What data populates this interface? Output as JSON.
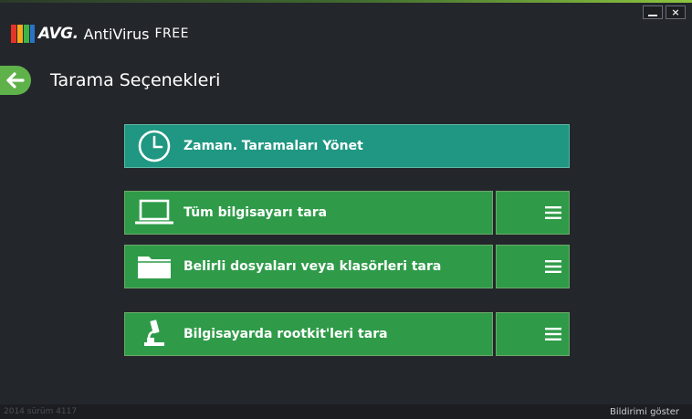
{
  "window": {
    "brand": "AVG.",
    "product": "AntiVirus",
    "edition": "FREE",
    "minimize_icon": "minimize-icon",
    "close_symbol": "×"
  },
  "page": {
    "title": "Tarama Seçenekleri"
  },
  "tiles": {
    "scheduled": {
      "label": "Zaman. Taramaları Yönet",
      "icon": "clock-icon"
    },
    "full": {
      "label": "Tüm bilgisayarı tara",
      "icon": "laptop-icon"
    },
    "files": {
      "label": "Belirli dosyaları veya klasörleri tara",
      "icon": "folder-icon"
    },
    "rootkit": {
      "label": "Bilgisayarda rootkit'leri tara",
      "icon": "microscope-icon"
    }
  },
  "footer": {
    "version": "2014  sürüm 4117",
    "notify": "Bildirimi göster"
  },
  "colors": {
    "background": "#23262b",
    "teal_tile": "#1f9782",
    "green_tile": "#2f9b49",
    "back_button": "#5fb24a"
  }
}
